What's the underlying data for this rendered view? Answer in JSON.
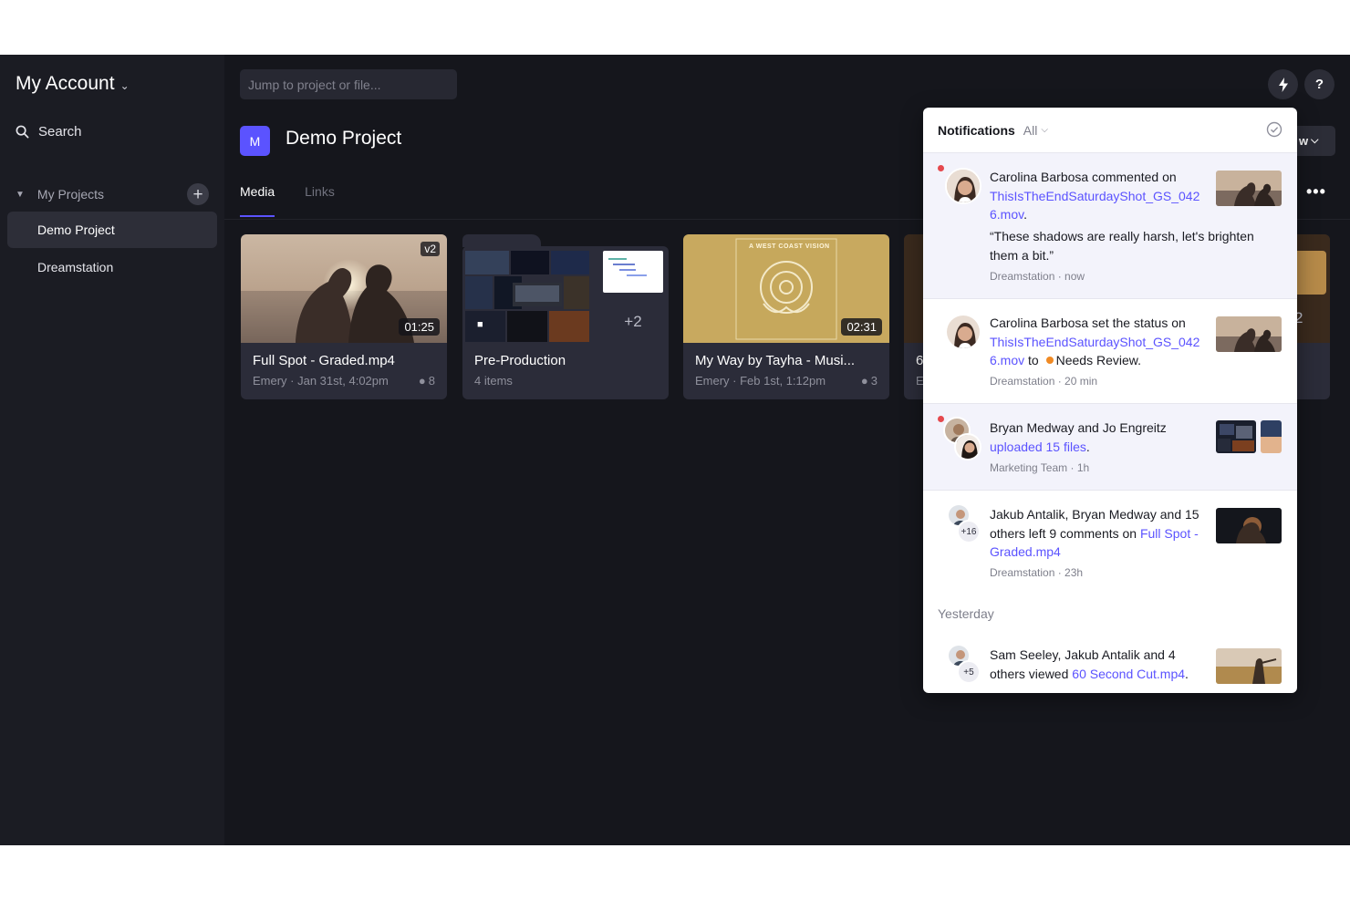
{
  "sidebar": {
    "account": "My Account",
    "search": "Search",
    "my_projects": "My Projects",
    "projects": [
      "Demo Project",
      "Dreamstation"
    ]
  },
  "header": {
    "jump_placeholder": "Jump to project or file...",
    "help": "?",
    "view_label": "w"
  },
  "project": {
    "avatar": "M",
    "title": "Demo Project",
    "tabs": [
      "Media",
      "Links"
    ]
  },
  "cards": [
    {
      "title": "Full Spot - Graded.mp4",
      "meta": "Emery · Jan 31st, 4:02pm",
      "comments": "8",
      "duration": "01:25",
      "version": "v2"
    },
    {
      "title": "Pre-Production",
      "meta": "4 items",
      "more": "+2"
    },
    {
      "title": "My Way by Tayha - Musi...",
      "meta": "Emery · Feb 1st, 1:12pm",
      "comments": "3",
      "duration": "02:31",
      "cover_text": "A WEST COAST VISION"
    },
    {
      "title": "6",
      "meta": "E",
      "more": "2"
    }
  ],
  "notifications": {
    "title": "Notifications",
    "filter": "All",
    "section_yesterday": "Yesterday",
    "items": [
      {
        "text": "Carolina Barbosa commented on ",
        "link": "ThisIsTheEndSaturdayShot_GS_0426.mov",
        "link_l1": "ThisIsTheEndSaturdayShot_GS_042",
        "link_l2": "6.mov",
        "suffix": ".",
        "quote": "“These shadows are really harsh, let's brighten them a bit.”",
        "meta": "Dreamstation · now"
      },
      {
        "text": "Carolina Barbosa set the status on ",
        "link_l1": "ThisIsTheEndSaturdayShot_GS_042",
        "link_l2": "6.mov",
        "mid": " to ",
        "status": "Needs Review.",
        "meta": "Dreamstation · 20 min"
      },
      {
        "text": "Bryan Medway and Jo Engreitz ",
        "link": "uploaded 15 files",
        "suffix": ".",
        "meta": "Marketing Team · 1h"
      },
      {
        "text": "Jakub Antalik, Bryan Medway and 15 others left 9 comments on ",
        "link": "Full Spot - Graded.mp4",
        "badge": "+16",
        "meta": "Dreamstation · 23h"
      },
      {
        "text": "Sam Seeley, Jakub Antalik and 4 others viewed ",
        "link": "60 Second Cut.mp4",
        "suffix": ".",
        "badge": "+5"
      }
    ]
  },
  "colors": {
    "accent": "#5b53ff",
    "background": "#15161c",
    "sidebar": "#1b1c23",
    "unread_dot": "#e5484d",
    "status_needs_review": "#f08a24"
  }
}
